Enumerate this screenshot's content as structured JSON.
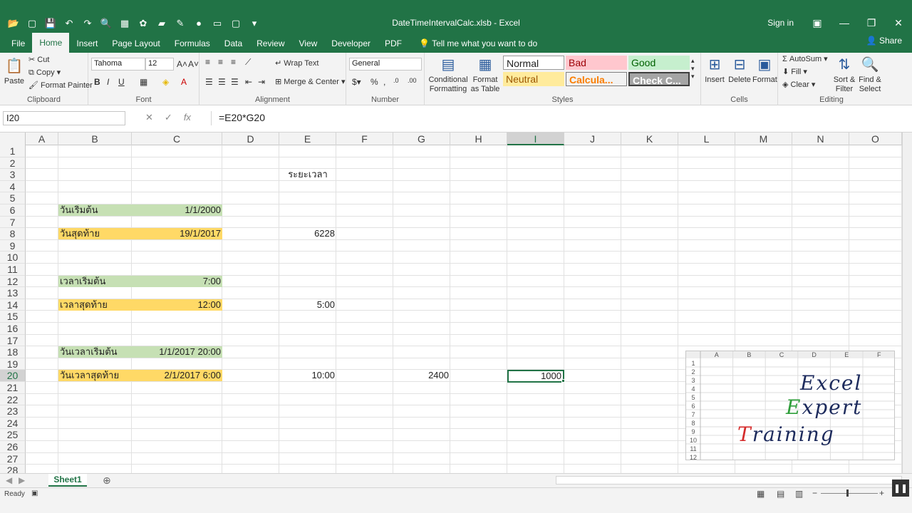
{
  "window": {
    "title": "DateTimeIntervalCalc.xlsb - Excel",
    "signin": "Sign in"
  },
  "ribbon_tabs": [
    "File",
    "Home",
    "Insert",
    "Page Layout",
    "Formulas",
    "Data",
    "Review",
    "View",
    "Developer",
    "PDF"
  ],
  "tell_me": "Tell me what you want to do",
  "share": "Share",
  "clipboard": {
    "paste": "Paste",
    "cut": "Cut",
    "copy": "Copy",
    "format_painter": "Format Painter",
    "label": "Clipboard"
  },
  "font": {
    "name": "Tahoma",
    "size": "12",
    "label": "Font"
  },
  "alignment": {
    "wrap": "Wrap Text",
    "merge": "Merge & Center",
    "label": "Alignment"
  },
  "number": {
    "format": "General",
    "label": "Number"
  },
  "styles": {
    "conditional": "Conditional Formatting",
    "format_table": "Format as Table",
    "normal": "Normal",
    "bad": "Bad",
    "good": "Good",
    "neutral": "Neutral",
    "calculation": "Calcula...",
    "check": "Check C...",
    "label": "Styles"
  },
  "cells_group": {
    "insert": "Insert",
    "delete": "Delete",
    "format": "Format",
    "label": "Cells"
  },
  "editing": {
    "autosum": "AutoSum",
    "fill": "Fill",
    "clear": "Clear",
    "sort": "Sort & Filter",
    "find": "Find & Select",
    "label": "Editing"
  },
  "formula_bar": {
    "name_box": "I20",
    "formula": "=E20*G20"
  },
  "columns": [
    "A",
    "B",
    "C",
    "D",
    "E",
    "F",
    "G",
    "H",
    "I",
    "J",
    "K",
    "L",
    "M",
    "N",
    "O"
  ],
  "rows": [
    "1",
    "2",
    "3",
    "4",
    "5",
    "6",
    "7",
    "8",
    "9",
    "10",
    "11",
    "12",
    "13",
    "14",
    "15",
    "16",
    "17",
    "18",
    "19",
    "20",
    "21",
    "22",
    "23",
    "24",
    "25",
    "26",
    "27",
    "28"
  ],
  "cells": {
    "E3": "ระยะเวลา",
    "B6": "วันเริ่มต้น",
    "C6": "1/1/2000",
    "B8": "วันสุดท้าย",
    "C8": "19/1/2017",
    "E8": "6228",
    "B12": "เวลาเริ่มต้น",
    "C12": "7:00",
    "B14": "เวลาสุดท้าย",
    "C14": "12:00",
    "E14": "5:00",
    "B18": "วันเวลาเริ่มต้น",
    "C18": "1/1/2017 20:00",
    "B20": "วันเวลาสุดท้าย",
    "C20": "2/1/2017 6:00",
    "E20": "10:00",
    "G20": "2400",
    "I20": "1000"
  },
  "logo": {
    "cols": [
      "A",
      "B",
      "C",
      "D",
      "E",
      "F"
    ],
    "rows": [
      "1",
      "2",
      "3",
      "4",
      "5",
      "6",
      "7",
      "8",
      "9",
      "10",
      "11",
      "12"
    ],
    "line1": "Excel",
    "line2": "Expert",
    "line3": "Training"
  },
  "sheet": {
    "name": "Sheet1"
  },
  "status": {
    "ready": "Ready"
  },
  "colors": {
    "green_fill": "#c6e0b4",
    "yellow_fill": "#ffd966",
    "excel_green": "#217346"
  }
}
